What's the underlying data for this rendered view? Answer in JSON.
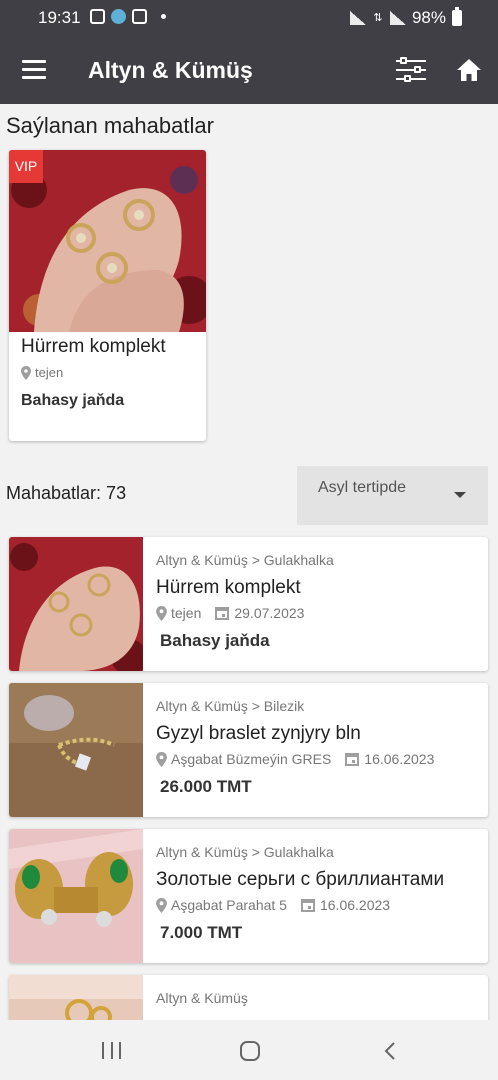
{
  "status_bar": {
    "time": "19:31",
    "battery": "98%"
  },
  "app_bar": {
    "title": "Altyn & Kümüş"
  },
  "featured": {
    "section_title": "Saýlanan mahabatlar",
    "badge": "VIP",
    "title": "Hürrem komplekt",
    "location": "tejen",
    "price": "Bahasy jaňda"
  },
  "listing": {
    "count_label": "Mahabatlar: 73",
    "sort": {
      "selected": "Asyl tertipde"
    },
    "items": [
      {
        "category": "Altyn & Kümüş > Gulakhalka",
        "title": "Hürrem komplekt",
        "location": "tejen",
        "date": "29.07.2023",
        "price": "Bahasy jaňda"
      },
      {
        "category": "Altyn & Kümüş > Bilezik",
        "title": "Gyzyl braslet zynjyry bln",
        "location": "Aşgabat Büzmeýin GRES",
        "date": "16.06.2023",
        "price": "26.000 TMT"
      },
      {
        "category": "Altyn & Kümüş > Gulakhalka",
        "title": "Золотые серьги с бриллиантами",
        "location": "Aşgabat Parahat 5",
        "date": "16.06.2023",
        "price": "7.000 TMT"
      },
      {
        "category": "Altyn & Kümüş",
        "title": "",
        "location": "",
        "date": "",
        "price": ""
      }
    ]
  },
  "colors": {
    "app_bar": "#3f3f45",
    "vip_badge": "#e53935",
    "background": "#f2f2f2"
  }
}
